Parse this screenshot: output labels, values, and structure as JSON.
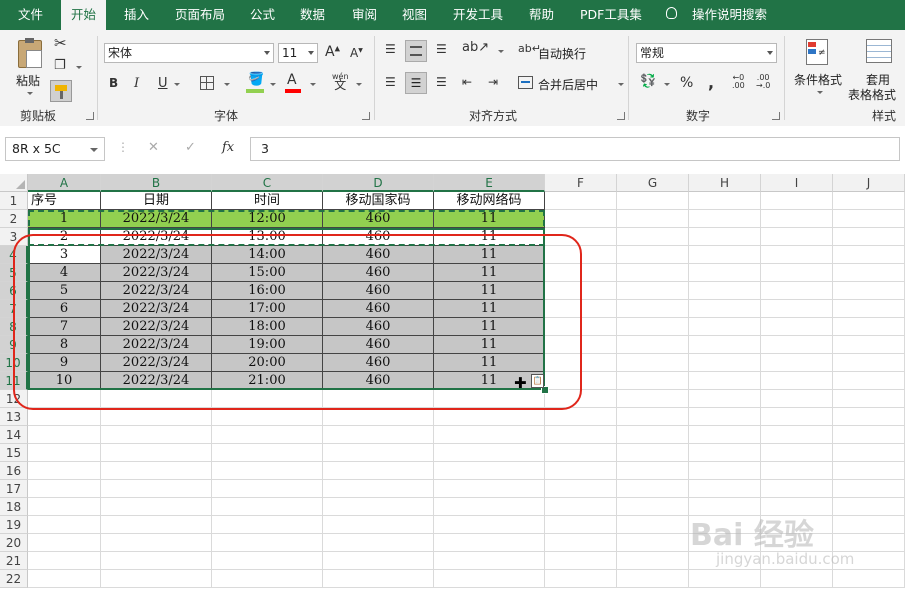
{
  "tabs": [
    "文件",
    "开始",
    "插入",
    "页面布局",
    "公式",
    "数据",
    "审阅",
    "视图",
    "开发工具",
    "帮助",
    "PDF工具集",
    "操作说明搜索"
  ],
  "active_tab": "开始",
  "ribbon": {
    "clipboard": {
      "paste_label": "粘贴",
      "group_label": "剪贴板"
    },
    "font": {
      "family": "宋体",
      "size": "11",
      "group_label": "字体",
      "bold": "B",
      "italic": "I",
      "underline": "U",
      "wen_label": "wén",
      "fill_color": "#92d050",
      "font_color": "#ff0000"
    },
    "alignment": {
      "wrap_label": "自动换行",
      "merge_label": "合并后居中",
      "group_label": "对齐方式"
    },
    "number": {
      "format": "常规",
      "group_label": "数字",
      "percent": "%",
      "comma": ","
    },
    "styles": {
      "cond_label": "条件格式",
      "table_label_1": "套用",
      "table_label_2": "表格格式",
      "group_label": "样式"
    }
  },
  "formula_bar": {
    "name_box": "8R x 5C",
    "cancel": "✕",
    "enter": "✓",
    "fx": "fx",
    "value": "3"
  },
  "columns": [
    "A",
    "B",
    "C",
    "D",
    "E",
    "F",
    "G",
    "H",
    "I",
    "J"
  ],
  "row_numbers": [
    "1",
    "2",
    "3",
    "4",
    "5",
    "6",
    "7",
    "8",
    "9",
    "10",
    "11",
    "12",
    "13",
    "14",
    "15",
    "16",
    "17",
    "18",
    "19",
    "20",
    "21",
    "22"
  ],
  "table": {
    "headers": [
      "序号",
      "日期",
      "时间",
      "移动国家码",
      "移动网络码"
    ],
    "rows": [
      [
        "1",
        "2022/3/24",
        "12:00",
        "460",
        "11"
      ],
      [
        "2",
        "2022/3/24",
        "13:00",
        "460",
        "11"
      ],
      [
        "3",
        "2022/3/24",
        "14:00",
        "460",
        "11"
      ],
      [
        "4",
        "2022/3/24",
        "15:00",
        "460",
        "11"
      ],
      [
        "5",
        "2022/3/24",
        "16:00",
        "460",
        "11"
      ],
      [
        "6",
        "2022/3/24",
        "17:00",
        "460",
        "11"
      ],
      [
        "7",
        "2022/3/24",
        "18:00",
        "460",
        "11"
      ],
      [
        "8",
        "2022/3/24",
        "19:00",
        "460",
        "11"
      ],
      [
        "9",
        "2022/3/24",
        "20:00",
        "460",
        "11"
      ],
      [
        "10",
        "2022/3/24",
        "21:00",
        "460",
        "11"
      ]
    ]
  },
  "colors": {
    "accent": "#217346",
    "row2_fill": "#92d050",
    "selection_fill": "#c6c6c6",
    "annotation": "#e0261b"
  },
  "watermark": {
    "logo": "Bai 经验",
    "url": "jingyan.baidu.com"
  }
}
